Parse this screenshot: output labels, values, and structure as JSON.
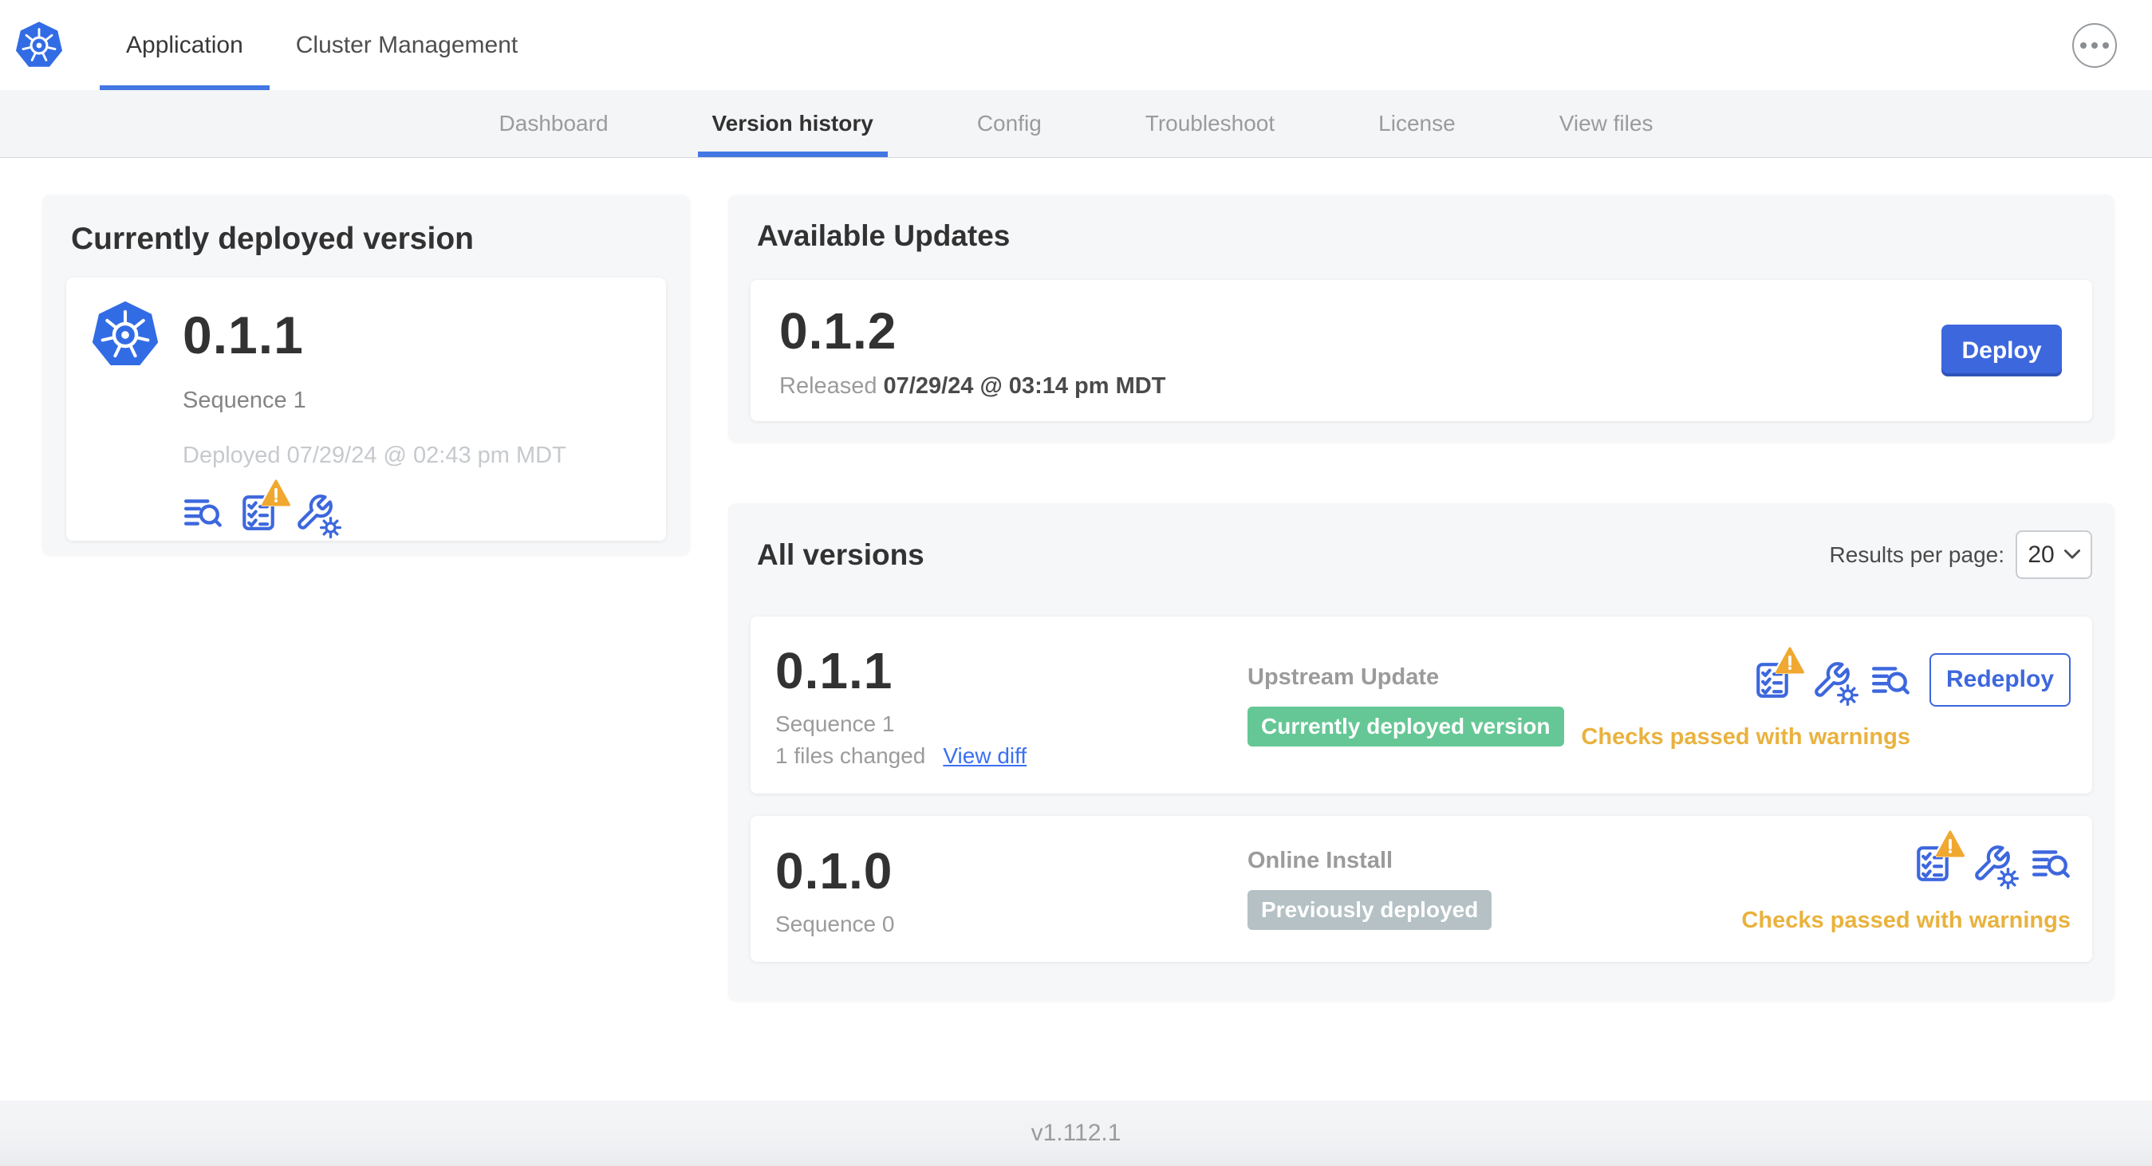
{
  "colors": {
    "accent_blue": "#3d67dd",
    "link_blue": "#3b70f2",
    "kubernetes_blue": "#326ce5",
    "active_underline": "#4377e2",
    "green_badge": "#65c795",
    "gray_badge": "#b5c1c4",
    "warning_orange": "#e9b23e",
    "warning_triangle": "#f0a830",
    "panel_background": "#f6f7f9",
    "nav_background": "#f4f5f7"
  },
  "icons": {
    "brand": "kubernetes-logo",
    "overflow": "ellipsis-menu-icon",
    "logs": "deploy-logs-icon",
    "preflight": "preflight-checklist-icon",
    "preflight_warning": "warning-triangle-icon",
    "config": "config-wrench-icon",
    "select_chevron": "chevron-down-icon"
  },
  "topnav": {
    "tabs": [
      "Application",
      "Cluster Management"
    ],
    "active": "Application"
  },
  "subnav": {
    "tabs": [
      "Dashboard",
      "Version history",
      "Config",
      "Troubleshoot",
      "License",
      "View files"
    ],
    "active": "Version history"
  },
  "current_version": {
    "title": "Currently deployed version",
    "version": "0.1.1",
    "sequence": "Sequence 1",
    "deployed": "Deployed 07/29/24 @ 02:43 pm MDT"
  },
  "available_updates": {
    "title": "Available Updates",
    "version": "0.1.2",
    "released_label": "Released",
    "released_date": "07/29/24 @ 03:14 pm MDT",
    "deploy_button": "Deploy"
  },
  "all_versions": {
    "title": "All versions",
    "results_per_page_label": "Results per page:",
    "results_per_page_value": "20",
    "rows": [
      {
        "version": "0.1.1",
        "sequence": "Sequence 1",
        "files_changed": "1 files changed",
        "view_diff_link": "View diff",
        "source": "Upstream Update",
        "badge": "Currently deployed version",
        "action_button": "Redeploy",
        "status": "Checks passed with warnings"
      },
      {
        "version": "0.1.0",
        "sequence": "Sequence 0",
        "source": "Online Install",
        "badge": "Previously deployed",
        "status": "Checks passed with warnings"
      }
    ]
  },
  "footer": {
    "console_version": "v1.112.1"
  }
}
